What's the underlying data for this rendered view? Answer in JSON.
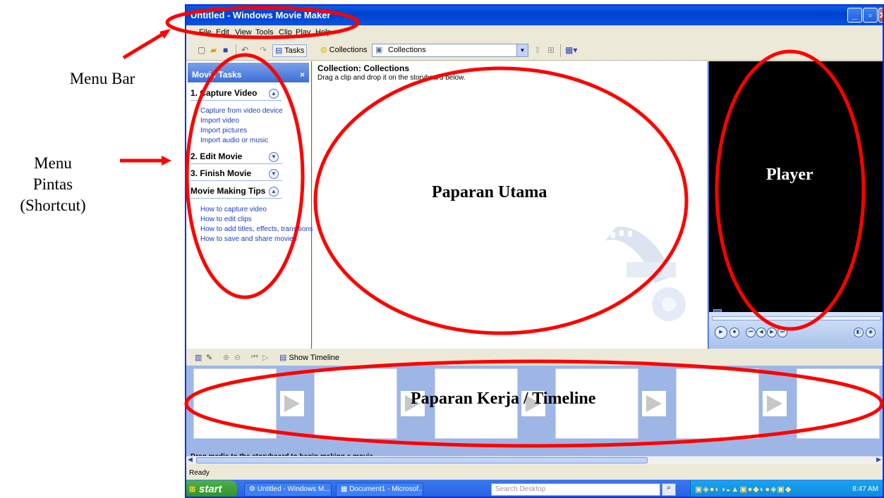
{
  "annotations": {
    "menu_bar": "Menu Bar",
    "menu_pintas_line1": "Menu",
    "menu_pintas_line2": "Pintas",
    "menu_pintas_line3": "(Shortcut)",
    "paparan_utama": "Paparan Utama",
    "player": "Player",
    "paparan_kerja": "Paparan Kerja / Timeline",
    "annotation_color": "#ff0000"
  },
  "window": {
    "title": "Untitled - Windows Movie Maker",
    "minimize": "_",
    "maximize": "▫",
    "close": "✕"
  },
  "menu": [
    "File",
    "Edit",
    "View",
    "Tools",
    "Clip",
    "Play",
    "Help"
  ],
  "toolbar": {
    "tasks_label": "Tasks",
    "collections_label": "Collections",
    "collections_select": "Collections"
  },
  "task_pane": {
    "header": "Movie Tasks",
    "close": "×",
    "sections": [
      {
        "title": "1. Capture Video",
        "expanded": true,
        "links": [
          "Capture from video device",
          "Import video",
          "Import pictures",
          "Import audio or music"
        ]
      },
      {
        "title": "2. Edit Movie",
        "expanded": false,
        "links": []
      },
      {
        "title": "3. Finish Movie",
        "expanded": false,
        "links": []
      },
      {
        "title": "Movie Making Tips",
        "expanded": true,
        "links": [
          "How to capture video",
          "How to edit clips",
          "How to add titles, effects, transitions",
          "How to save and share movies"
        ]
      }
    ]
  },
  "content": {
    "heading": "Collection: Collections",
    "subtext": "Drag a clip and drop it on the storyboard below."
  },
  "storyboard": {
    "show_timeline": "Show Timeline",
    "drag_text": "Drag media to the storyboard to begin making a movie."
  },
  "status": "Ready",
  "taskbar": {
    "start": "start",
    "tasks": [
      "Untitled - Windows M...",
      "Document1 - Microsof..."
    ],
    "search_placeholder": "Search Desktop",
    "clock": "8:47 AM"
  }
}
